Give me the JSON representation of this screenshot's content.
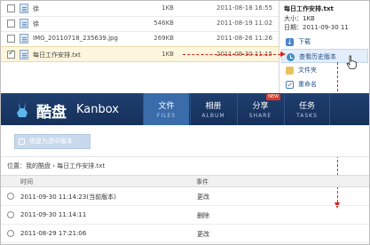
{
  "files": [
    {
      "name": "徐",
      "size": "1KB",
      "date": "2011-08-18 16:55",
      "checked": false
    },
    {
      "name": "徐",
      "size": "546KB",
      "date": "2011-08-19 11:02",
      "checked": false
    },
    {
      "name": "IMG_20110718_235639.jpg",
      "size": "269KB",
      "date": "2011-08-26 11:26",
      "checked": false
    },
    {
      "name": "每日工作安排.txt",
      "size": "1KB",
      "date": "2011-09-30 11:15",
      "checked": true
    }
  ],
  "info": {
    "title": "每日工作安排.txt",
    "size": "大小：1KB",
    "date": "日期：2011-09-30 11"
  },
  "menu": [
    {
      "label": "下载",
      "icon": "download-icon"
    },
    {
      "label": "查看历史版本",
      "icon": "history-icon"
    },
    {
      "label": "文件夹",
      "icon": "folder-icon"
    },
    {
      "label": "重命名",
      "icon": "rename-icon"
    }
  ],
  "header": {
    "logo_cn": "酷盘",
    "logo_en": "Kanbox",
    "tabs": [
      {
        "cn": "文件",
        "en": "FILES"
      },
      {
        "cn": "相册",
        "en": "ALBUM"
      },
      {
        "cn": "分享",
        "en": "SHARE",
        "badge": "NEW"
      },
      {
        "cn": "任务",
        "en": "TASKS"
      }
    ]
  },
  "restore_button": "恢复为选中版本",
  "breadcrumb": "位置：我的酷盘 › 每日工作安排.txt",
  "history": {
    "col_time": "时间",
    "col_event": "事件",
    "rows": [
      {
        "time": "2011-09-30 11:14:23(当前版本)",
        "event": "更改"
      },
      {
        "time": "2011-09-30 11:14:11",
        "event": "删除"
      },
      {
        "time": "2011-08-29 17:21:06",
        "event": "更改"
      }
    ]
  },
  "colors": {
    "header_bg": "#1f3f6f",
    "active_tab": "#3a6cab",
    "arrow": "#d9261c",
    "selected_row": "#fdf6dc"
  }
}
